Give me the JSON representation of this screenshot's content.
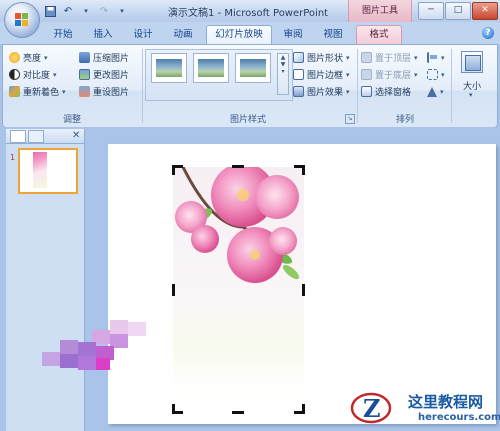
{
  "window": {
    "title": "演示文稿1 - Microsoft PowerPoint",
    "context_tab": "图片工具",
    "controls": [
      "─",
      "□",
      "✕"
    ]
  },
  "tabs": [
    {
      "label": "开始"
    },
    {
      "label": "插入"
    },
    {
      "label": "设计"
    },
    {
      "label": "动画"
    },
    {
      "label": "幻灯片放映"
    },
    {
      "label": "审阅"
    },
    {
      "label": "视图"
    },
    {
      "label": "格式"
    }
  ],
  "active_tab": "格式",
  "ribbon": {
    "adjust": {
      "label": "调整",
      "buttons": [
        "亮度",
        "对比度",
        "重新着色",
        "压缩图片",
        "更改图片",
        "重设图片"
      ]
    },
    "picture_styles": {
      "label": "图片样式",
      "buttons": [
        "图片形状",
        "图片边框",
        "图片效果"
      ]
    },
    "arrange": {
      "label": "排列",
      "buttons": [
        "置于顶层",
        "置于底层",
        "选择窗格"
      ]
    },
    "size": {
      "label": "大小"
    }
  },
  "slides_pane": {
    "slide_number": "1"
  },
  "watermark": {
    "title": "这里教程网",
    "url": "herecours.com"
  }
}
